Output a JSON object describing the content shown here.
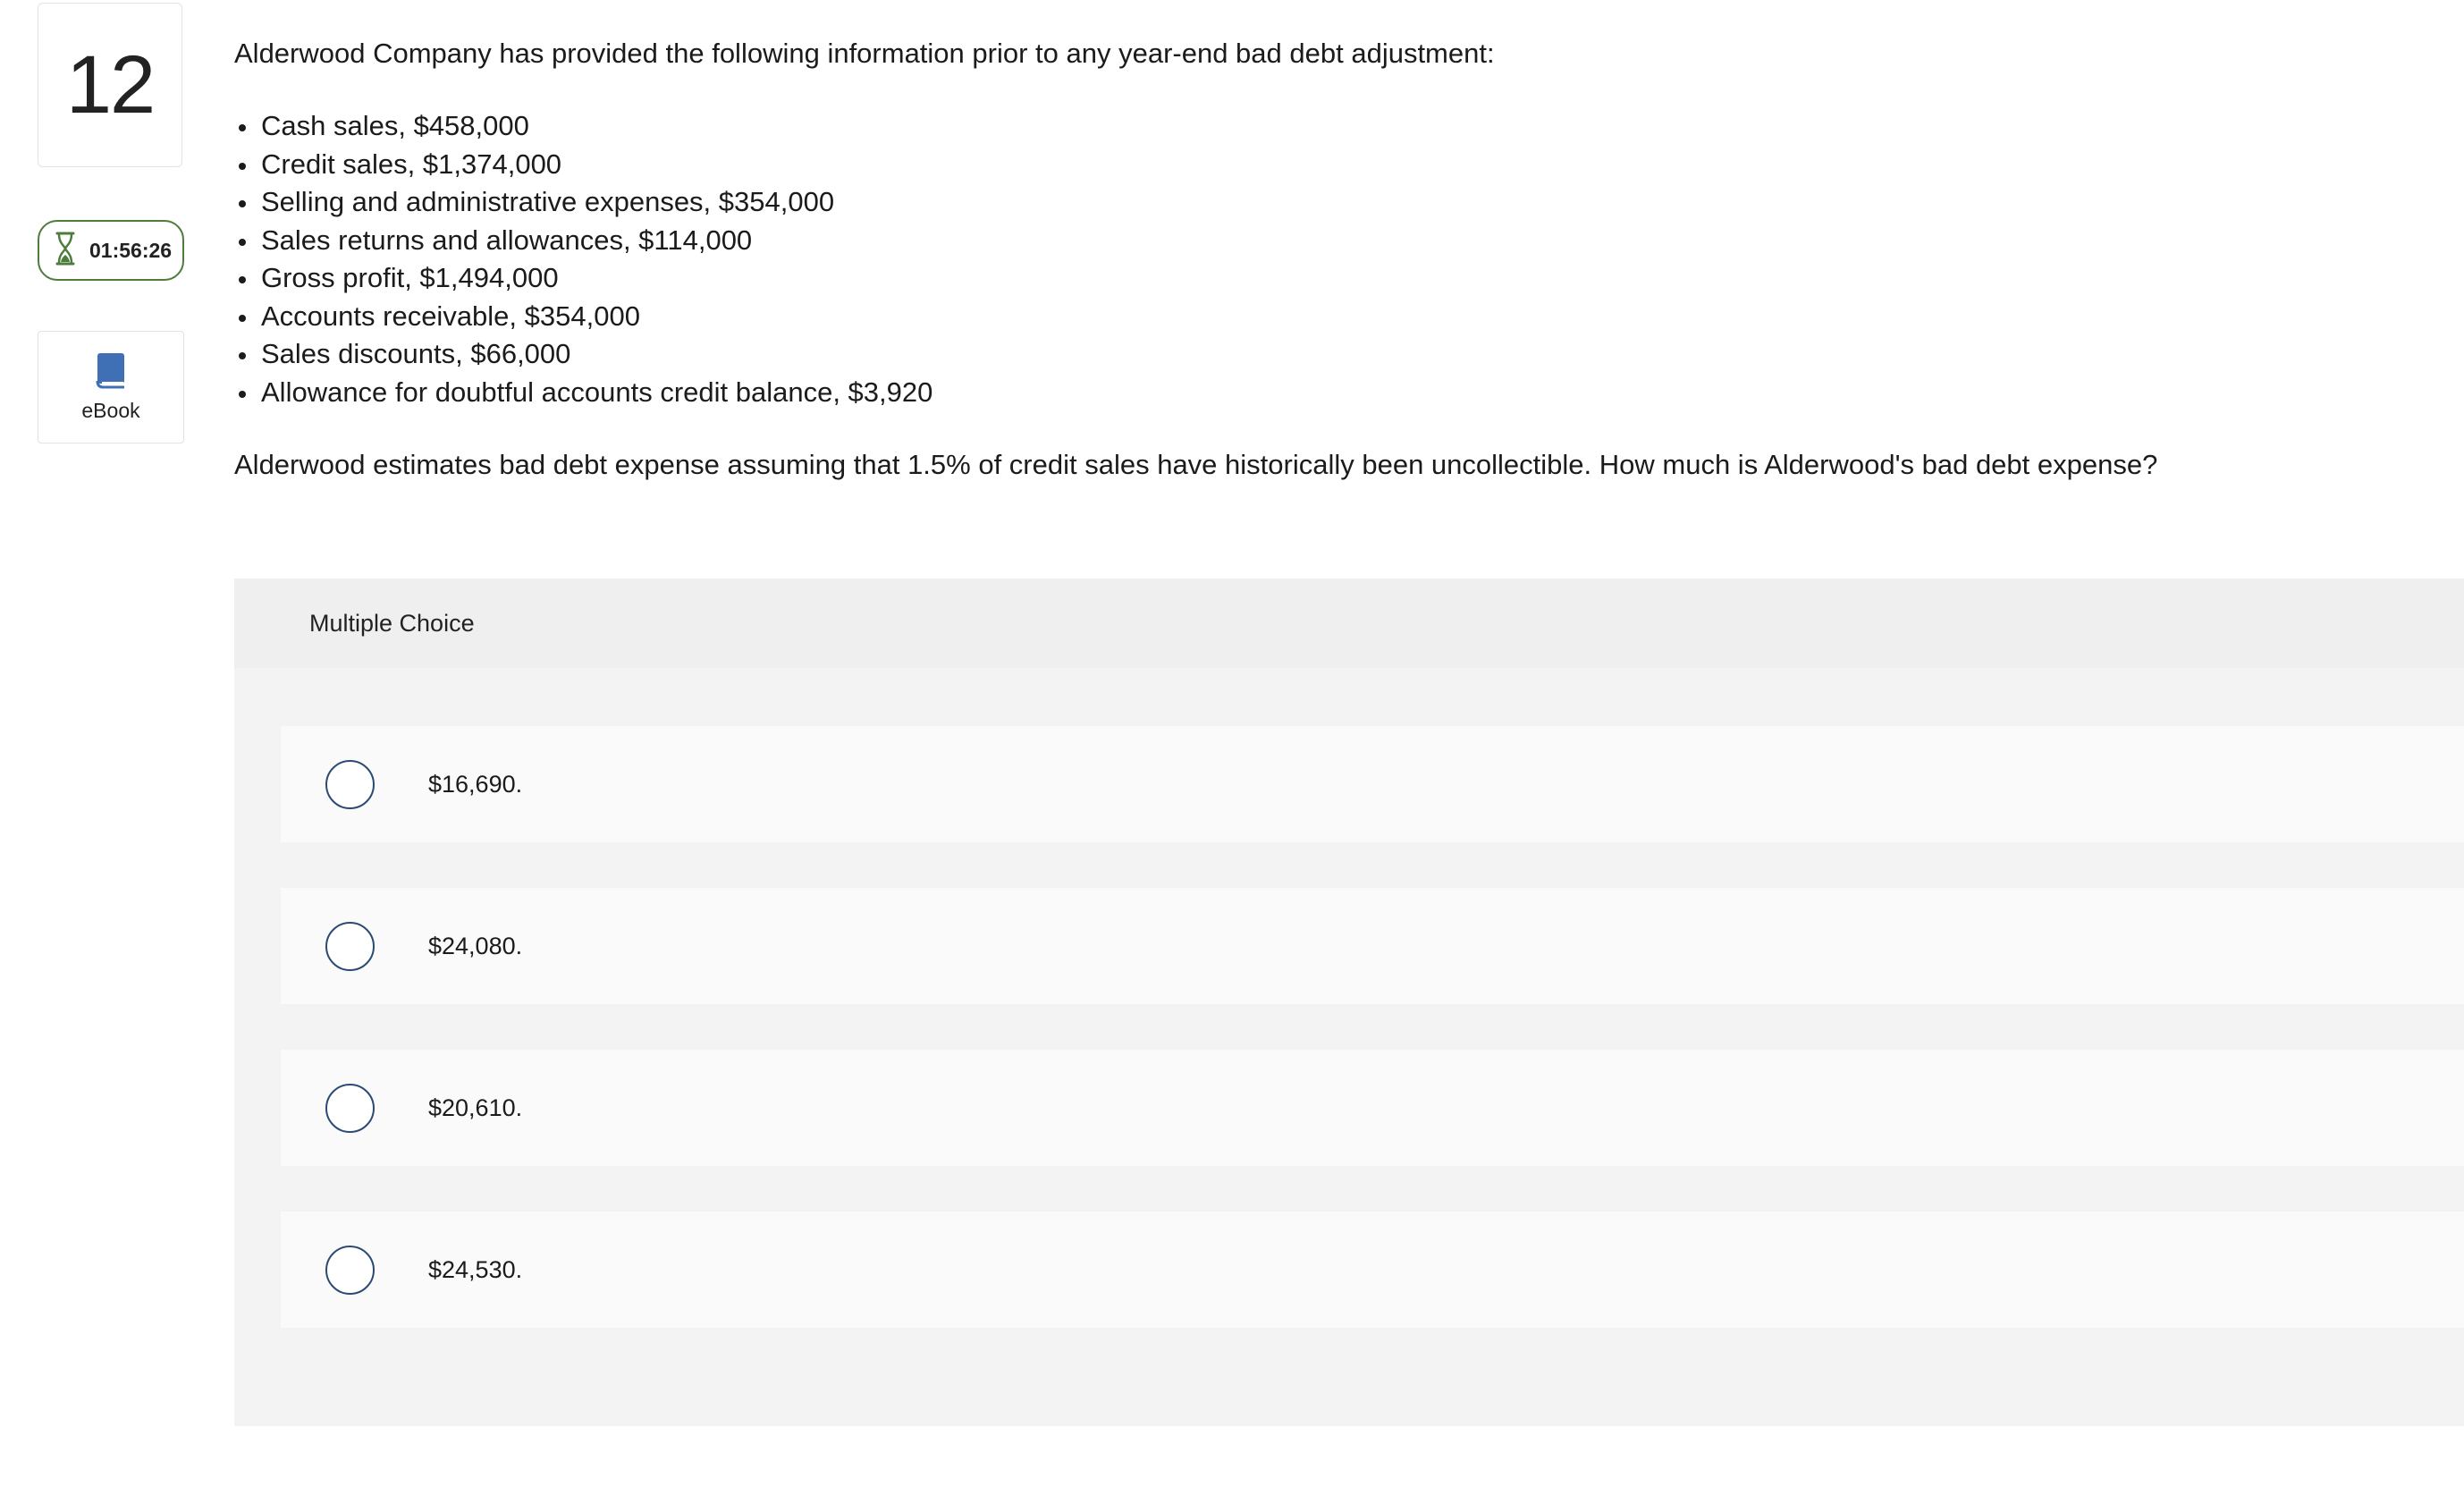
{
  "question": {
    "number": "12",
    "timer": "01:56:26",
    "ebook_label": "eBook",
    "intro": "Alderwood Company has provided the following information prior to any year-end bad debt adjustment:",
    "facts": [
      "Cash sales, $458,000",
      "Credit sales, $1,374,000",
      "Selling and administrative expenses, $354,000",
      "Sales returns and allowances, $114,000",
      "Gross profit, $1,494,000",
      "Accounts receivable, $354,000",
      "Sales discounts, $66,000",
      "Allowance for doubtful accounts credit balance, $3,920"
    ],
    "prompt": "Alderwood estimates bad debt expense assuming that 1.5% of credit sales have historically been uncollectible. How much is Alderwood's bad debt expense?"
  },
  "multiple_choice": {
    "header": "Multiple Choice",
    "options": [
      "$16,690.",
      "$24,080.",
      "$20,610.",
      "$24,530."
    ]
  },
  "colors": {
    "timer_border": "#4d7d3c",
    "radio_border": "#2b4a73",
    "ebook_icon": "#3f6fb5",
    "panel_bg": "#f3f3f3",
    "choice_bg": "#fafafa"
  },
  "icons": {
    "timer": "hourglass-icon",
    "ebook": "book-icon"
  }
}
